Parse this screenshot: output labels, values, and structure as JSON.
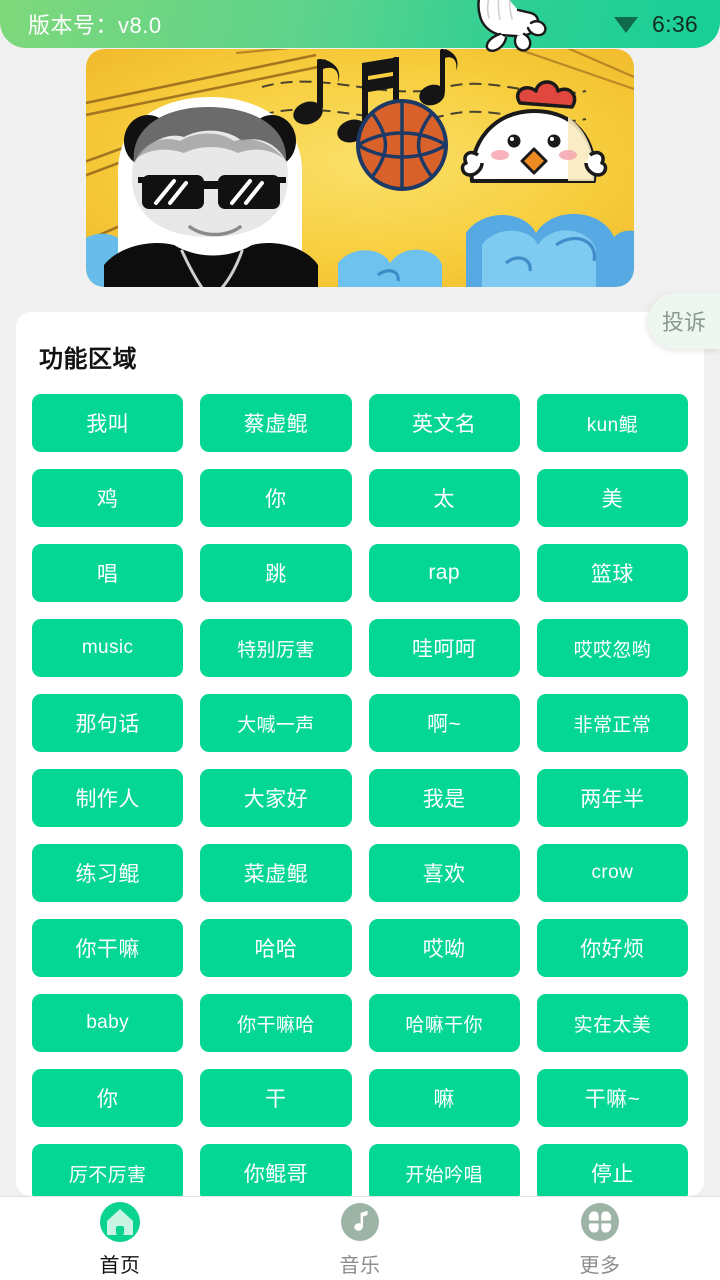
{
  "statusbar": {
    "version_label": "版本号：v8.0",
    "time": "6:36",
    "wifi_icon": "wifi-icon",
    "cursor_icon": "glove-cursor-icon"
  },
  "banner": {
    "name": "promo-banner",
    "alt": "卡通表情包横幅：熊猫人墨镜、音符、篮球、小鸡、蓝色云朵",
    "background_color": "#F5C430",
    "elements": [
      "panda-meme-face",
      "music-notes",
      "basketball",
      "chicken",
      "blue-clouds"
    ]
  },
  "complaint": {
    "label": "投诉"
  },
  "card": {
    "title": "功能区域",
    "buttons": [
      "我叫",
      "蔡虚鲲",
      "英文名",
      "kun鲲",
      "鸡",
      "你",
      "太",
      "美",
      "唱",
      "跳",
      "rap",
      "篮球",
      "music",
      "特别厉害",
      "哇呵呵",
      "哎哎忽哟",
      "那句话",
      "大喊一声",
      "啊~",
      "非常正常",
      "制作人",
      "大家好",
      "我是",
      "两年半",
      "练习鲲",
      "菜虚鲲",
      "喜欢",
      "crow",
      "你干嘛",
      "哈哈",
      "哎呦",
      "你好烦",
      "baby",
      "你干嘛哈",
      "哈嘛干你",
      "实在太美",
      "你",
      "干",
      "嘛",
      "干嘛~",
      "厉不厉害",
      "你鲲哥",
      "开始吟唱",
      "停止"
    ]
  },
  "bottom_nav": {
    "items": [
      {
        "label": "首页",
        "icon": "home-icon",
        "active": true
      },
      {
        "label": "音乐",
        "icon": "music-note-icon",
        "active": false
      },
      {
        "label": "更多",
        "icon": "grid-more-icon",
        "active": false
      }
    ]
  },
  "colors": {
    "accent_green": "#04D693",
    "header_gradient_start": "#7ED87A",
    "header_gradient_end": "#17CF96",
    "page_background": "#F0F0F0",
    "card_background": "#FFFFFF",
    "nav_inactive": "#8D8D8D"
  }
}
